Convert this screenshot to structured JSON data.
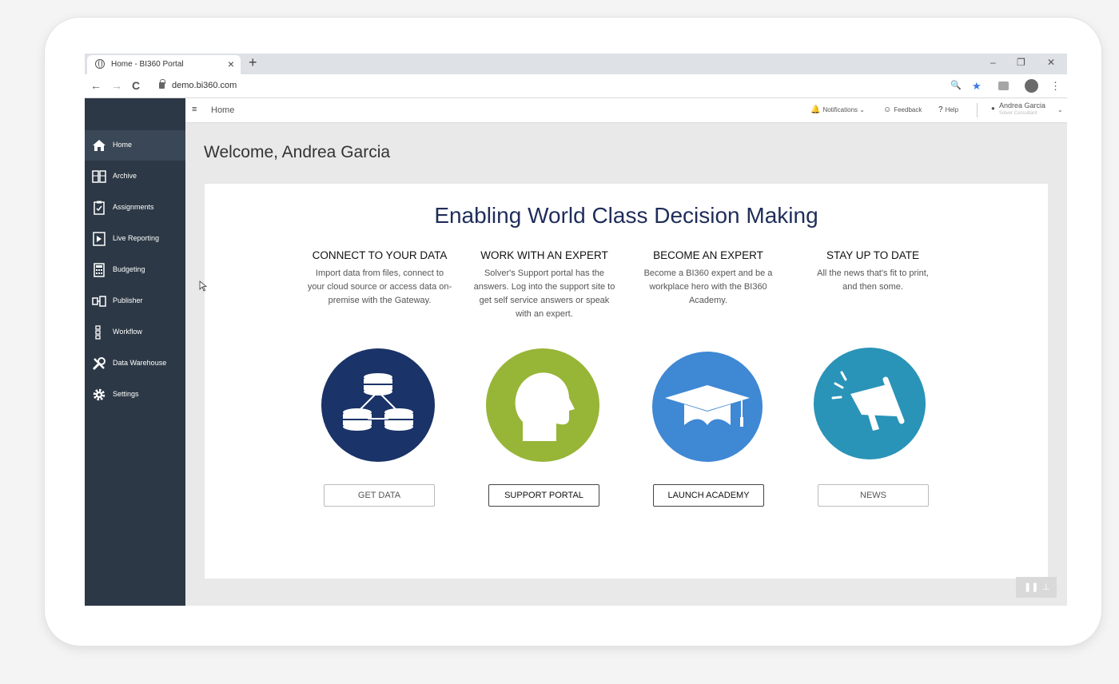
{
  "browser": {
    "tab_title": "Home - BI360 Portal",
    "tab_close": "×",
    "new_tab": "+",
    "win_min": "–",
    "win_max": "❐",
    "win_close": "✕",
    "back": "←",
    "forward": "→",
    "reload": "C",
    "url": "demo.bi360.com",
    "zoom": "🔍",
    "bookmark_star": "★",
    "menu_dots": "⋮"
  },
  "app": {
    "sidebar": {
      "items": [
        {
          "label": "Home",
          "icon": "home-icon"
        },
        {
          "label": "Archive",
          "icon": "archive-icon"
        },
        {
          "label": "Assignments",
          "icon": "clipboard-icon"
        },
        {
          "label": "Live Reporting",
          "icon": "report-icon"
        },
        {
          "label": "Budgeting",
          "icon": "calculator-icon"
        },
        {
          "label": "Publisher",
          "icon": "publisher-icon"
        },
        {
          "label": "Workflow",
          "icon": "workflow-icon"
        },
        {
          "label": "Data Warehouse",
          "icon": "tools-icon"
        },
        {
          "label": "Settings",
          "icon": "gear-icon"
        }
      ],
      "active": "Home"
    },
    "topbar": {
      "menu_icon": "≡",
      "breadcrumb": "Home",
      "notifications": "Notifications ⌄",
      "feedback": "Feedback",
      "help": "Help",
      "user_name": "Andrea Garcia",
      "user_subtitle": "Solver Consultant",
      "user_caret": "⌄"
    },
    "welcome": "Welcome, Andrea Garcia",
    "panel": {
      "headline": "Enabling World Class Decision Making",
      "columns": [
        {
          "title": "CONNECT TO YOUR DATA",
          "desc": "Import data from files, connect to your cloud source or access data on-premise with the Gateway.",
          "button": "GET DATA",
          "icon": "database-icon",
          "color": "#1a3368"
        },
        {
          "title": "WORK WITH AN EXPERT",
          "desc": "Solver's Support portal has the answers. Log into the support site to get self service answers or speak with an expert.",
          "button": "SUPPORT PORTAL",
          "icon": "head-icon",
          "color": "#97b537"
        },
        {
          "title": "BECOME AN EXPERT",
          "desc": "Become a BI360 expert and be a workplace hero with the BI360 Academy.",
          "button": "LAUNCH ACADEMY",
          "icon": "graduation-cap-icon",
          "color": "#3f88d4"
        },
        {
          "title": "STAY UP TO DATE",
          "desc": "All the news that's fit to print, and then some.",
          "button": "NEWS",
          "icon": "megaphone-icon",
          "color": "#2a93b8"
        }
      ]
    }
  }
}
